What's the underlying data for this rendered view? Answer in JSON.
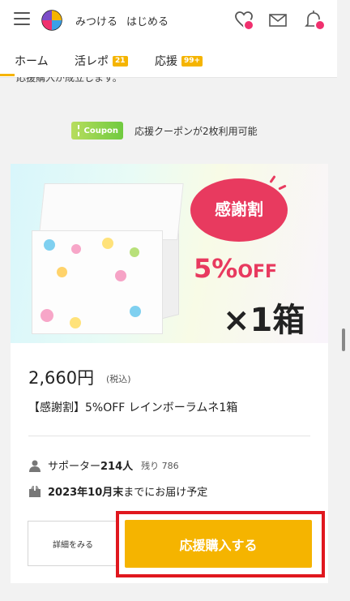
{
  "header": {
    "nav": [
      "みつける",
      "はじめる"
    ],
    "icons": [
      "menu-icon",
      "logo",
      "heart-icon",
      "mail-icon",
      "bell-icon"
    ],
    "accent": "#f0306e"
  },
  "tabs": [
    {
      "label": "ホーム",
      "count": ""
    },
    {
      "label": "活レポ",
      "count": "21"
    },
    {
      "label": "応援",
      "count": "99+"
    }
  ],
  "partial_notice": "応援購入が成立します。",
  "coupon": {
    "pill": "Coupon",
    "text": "応援クーポンが2枚利用可能"
  },
  "hero": {
    "badge": "感謝割",
    "discount_num": "5%",
    "discount_off": "OFF",
    "quantity": "×1箱"
  },
  "product": {
    "price": "2,660円",
    "tax": "(税込)",
    "title": "【感謝割】5%OFF レインボーラムネ1箱",
    "supporters_label": "サポーター",
    "supporters_count": "214人",
    "remaining": "残り 786",
    "delivery_bold": "2023年10月末",
    "delivery_rest": "までにお届け予定"
  },
  "buttons": {
    "detail": "詳細をみる",
    "buy": "応援購入する"
  },
  "colors": {
    "brand_yellow": "#f5b400",
    "highlight_red": "#e0171e",
    "discount_pink": "#e83a5f"
  }
}
